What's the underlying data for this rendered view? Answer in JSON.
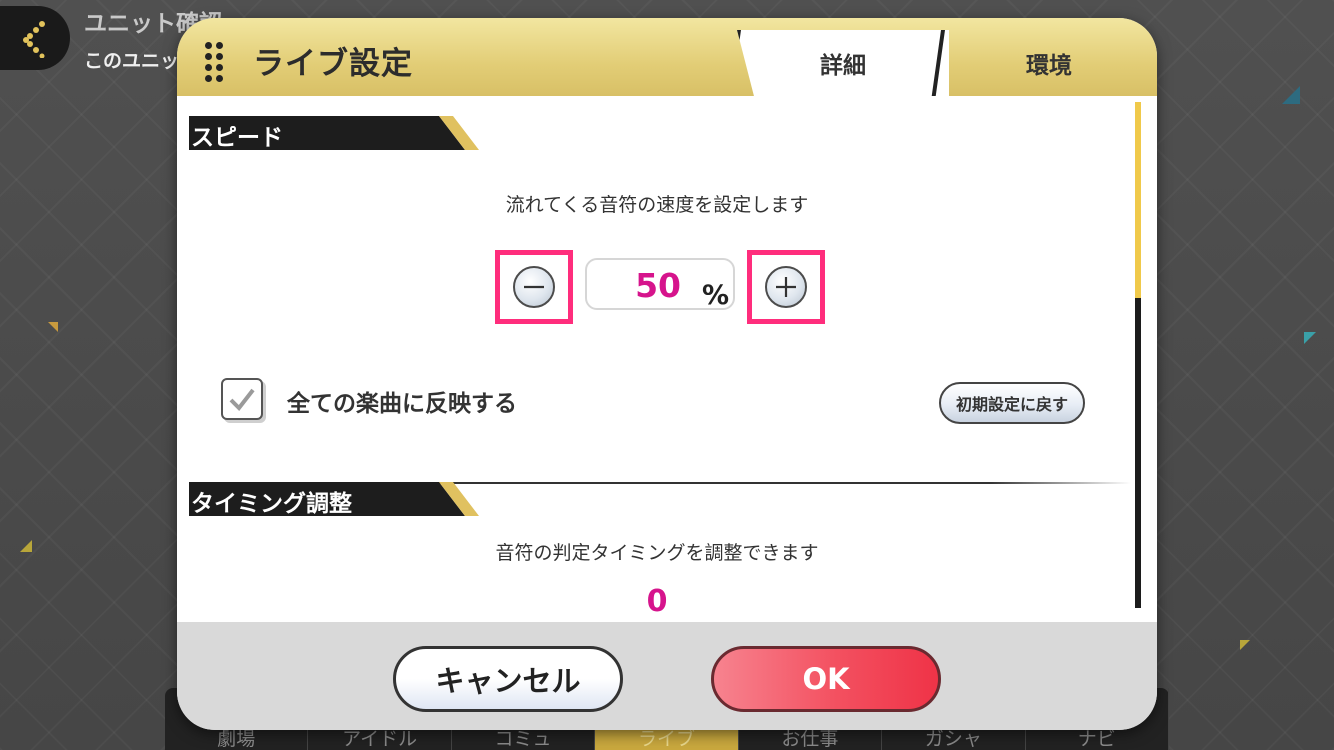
{
  "background": {
    "header_title": "ユニット確認",
    "header_subtitle": "このユニッ",
    "nav_items": [
      "劇場",
      "アイドル",
      "コミュ",
      "ライブ",
      "お仕事",
      "ガシャ",
      "ナビ"
    ]
  },
  "modal": {
    "title": "ライブ設定",
    "tabs": [
      {
        "label": "詳細",
        "active": true
      },
      {
        "label": "環境",
        "active": false
      }
    ],
    "speed": {
      "heading": "スピード",
      "description": "流れてくる音符の速度を設定します",
      "value": "50",
      "unit": "%",
      "apply_all_label": "全ての楽曲に反映する",
      "apply_all_checked": true,
      "reset_label": "初期設定に戻す"
    },
    "timing": {
      "heading": "タイミング調整",
      "description": "音符の判定タイミングを調整できます",
      "value": "0"
    },
    "footer": {
      "cancel_label": "キャンセル",
      "ok_label": "OK"
    }
  },
  "colors": {
    "accent_gold": "#e0c160",
    "value_magenta": "#d6148c",
    "highlight_pink": "#ff2d7c",
    "ok_red": "#f35060"
  },
  "icons": {
    "back": "chevron-left-icon",
    "grip": "grip-dots-icon",
    "minus": "minus-circle-icon",
    "plus": "plus-circle-icon",
    "check": "check-icon"
  }
}
